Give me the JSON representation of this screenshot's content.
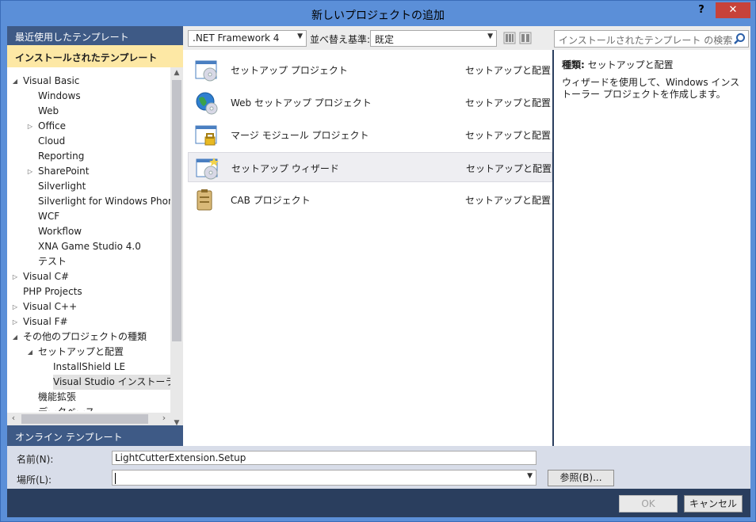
{
  "window": {
    "title": "新しいプロジェクトの追加",
    "help": "?",
    "close": "✕"
  },
  "left": {
    "recent_header": "最近使用したテンプレート",
    "installed_header": "インストールされたテンプレート",
    "online_header": "オンライン テンプレート",
    "tree": [
      {
        "label": "Visual Basic",
        "arrow": "◢"
      },
      {
        "label": "Windows",
        "arrow": ""
      },
      {
        "label": "Web",
        "arrow": ""
      },
      {
        "label": "Office",
        "arrow": "▷"
      },
      {
        "label": "Cloud",
        "arrow": ""
      },
      {
        "label": "Reporting",
        "arrow": ""
      },
      {
        "label": "SharePoint",
        "arrow": "▷"
      },
      {
        "label": "Silverlight",
        "arrow": ""
      },
      {
        "label": "Silverlight for Windows Phone",
        "arrow": ""
      },
      {
        "label": "WCF",
        "arrow": ""
      },
      {
        "label": "Workflow",
        "arrow": ""
      },
      {
        "label": "XNA Game Studio 4.0",
        "arrow": ""
      },
      {
        "label": "テスト",
        "arrow": ""
      },
      {
        "label": "Visual C#",
        "arrow": "▷"
      },
      {
        "label": "PHP Projects",
        "arrow": ""
      },
      {
        "label": "Visual C++",
        "arrow": "▷"
      },
      {
        "label": "Visual F#",
        "arrow": "▷"
      },
      {
        "label": "その他のプロジェクトの種類",
        "arrow": "◢"
      },
      {
        "label": "セットアップと配置",
        "arrow": "◢"
      },
      {
        "label": "InstallShield LE",
        "arrow": ""
      },
      {
        "label": "Visual Studio インストーラー",
        "arrow": ""
      },
      {
        "label": "機能拡張",
        "arrow": ""
      },
      {
        "label": "データベース",
        "arrow": ""
      }
    ],
    "selected_item": "Visual Studio インストーラー"
  },
  "toolbar": {
    "framework": ".NET Framework 4",
    "sort_label": "並べ替え基準:",
    "sort_value": "既定",
    "search_placeholder": "インストールされたテンプレート の検索"
  },
  "templates": [
    {
      "name": "セットアップ プロジェクト",
      "category": "セットアップと配置",
      "icon": "setup-project-icon"
    },
    {
      "name": "Web セットアップ プロジェクト",
      "category": "セットアップと配置",
      "icon": "web-setup-project-icon"
    },
    {
      "name": "マージ モジュール プロジェクト",
      "category": "セットアップと配置",
      "icon": "merge-module-icon"
    },
    {
      "name": "セットアップ ウィザード",
      "category": "セットアップと配置",
      "icon": "setup-wizard-icon"
    },
    {
      "name": "CAB プロジェクト",
      "category": "セットアップと配置",
      "icon": "cab-project-icon"
    }
  ],
  "highlighted_template": "セットアップ ウィザード",
  "detail": {
    "type_label": "種類:",
    "type_value": "セットアップと配置",
    "description": "ウィザードを使用して、Windows インストーラー プロジェクトを作成します。"
  },
  "form": {
    "name_label": "名前(N):",
    "name_value": "LightCutterExtension.Setup",
    "location_label": "場所(L):",
    "location_value": "",
    "browse_label": "参照(B)..."
  },
  "buttons": {
    "ok": "OK",
    "cancel": "キャンセル"
  },
  "colors": {
    "titlebar": "#5b8fd8",
    "dark_header": "#3e5a86",
    "selected_header": "#fde8a5",
    "close": "#c7423a"
  }
}
